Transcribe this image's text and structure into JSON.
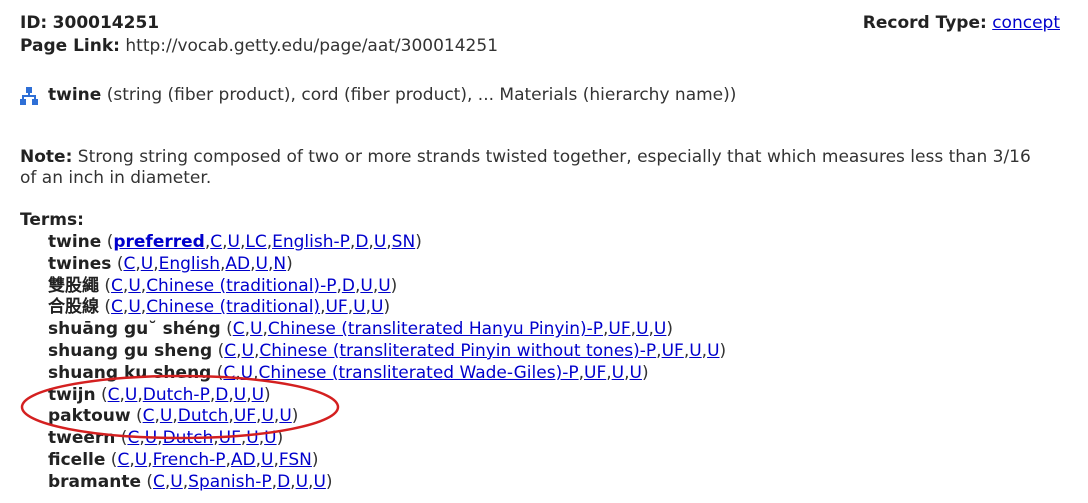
{
  "header": {
    "id_label": "ID:",
    "id_value": "300014251",
    "page_link_label": "Page Link:",
    "page_link_url": "http://vocab.getty.edu/page/aat/300014251",
    "record_type_label": "Record Type:",
    "record_type_value": "concept"
  },
  "hierarchy": {
    "icon": "hierarchy-icon",
    "term": "twine",
    "context": "(string (fiber product), cord (fiber product), ... Materials (hierarchy name))"
  },
  "note": {
    "label": "Note:",
    "line1": "Strong string composed of two or more strands twisted together, especially that which measures less than 3/16",
    "line2": "of an inch in diameter."
  },
  "terms": {
    "label": "Terms:",
    "items": [
      {
        "term": "twine",
        "flags": [
          "preferred",
          "C",
          "U",
          "LC",
          "English-P",
          "D",
          "U",
          "SN"
        ]
      },
      {
        "term": "twines",
        "flags": [
          "C",
          "U",
          "English",
          "AD",
          "U",
          "N"
        ]
      },
      {
        "term": "雙股繩",
        "flags": [
          "C",
          "U",
          "Chinese (traditional)-P",
          "D",
          "U",
          "U"
        ]
      },
      {
        "term": "合股線",
        "flags": [
          "C",
          "U",
          "Chinese (traditional)",
          "UF",
          "U",
          "U"
        ]
      },
      {
        "term": "shuāng gu˘ shéng",
        "flags": [
          "C",
          "U",
          "Chinese (transliterated Hanyu Pinyin)-P",
          "UF",
          "U",
          "U"
        ]
      },
      {
        "term": "shuang gu sheng",
        "flags": [
          "C",
          "U",
          "Chinese (transliterated Pinyin without tones)-P",
          "UF",
          "U",
          "U"
        ]
      },
      {
        "term": "shuang ku sheng",
        "flags": [
          "C",
          "U",
          "Chinese (transliterated Wade-Giles)-P",
          "UF",
          "U",
          "U"
        ]
      },
      {
        "term": "twijn",
        "flags": [
          "C",
          "U",
          "Dutch-P",
          "D",
          "U",
          "U"
        ]
      },
      {
        "term": "paktouw",
        "flags": [
          "C",
          "U",
          "Dutch",
          "UF",
          "U",
          "U"
        ]
      },
      {
        "term": "tweern",
        "flags": [
          "C",
          "U",
          "Dutch",
          "UF",
          "U",
          "U"
        ]
      },
      {
        "term": "ficelle",
        "flags": [
          "C",
          "U",
          "French-P",
          "AD",
          "U",
          "FSN"
        ]
      },
      {
        "term": "bramante",
        "flags": [
          "C",
          "U",
          "Spanish-P",
          "D",
          "U",
          "U"
        ]
      }
    ]
  },
  "colors": {
    "link": "#0000cc",
    "annotation": "#d42020"
  }
}
